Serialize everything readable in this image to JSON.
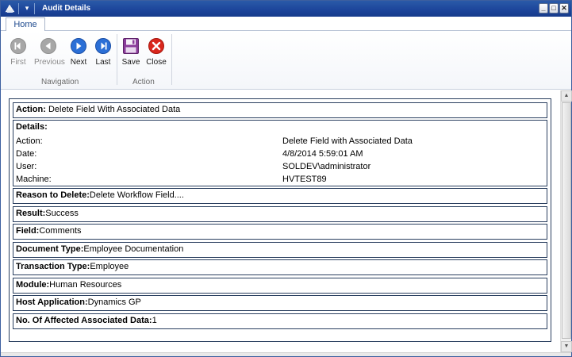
{
  "window": {
    "title": "Audit Details",
    "controls": {
      "minimize": "_",
      "maximize": "□",
      "close": "✕"
    }
  },
  "ribbon": {
    "tabs": [
      {
        "label": "Home"
      }
    ],
    "groups": [
      {
        "label": "Navigation",
        "buttons": [
          {
            "label": "First",
            "icon": "first-icon",
            "enabled": false
          },
          {
            "label": "Previous",
            "icon": "previous-icon",
            "enabled": false
          },
          {
            "label": "Next",
            "icon": "next-icon",
            "enabled": true
          },
          {
            "label": "Last",
            "icon": "last-icon",
            "enabled": true
          }
        ]
      },
      {
        "label": "Action",
        "buttons": [
          {
            "label": "Save",
            "icon": "save-icon",
            "enabled": true
          },
          {
            "label": "Close",
            "icon": "close-icon",
            "enabled": true
          }
        ]
      }
    ]
  },
  "audit": {
    "action": {
      "label": "Action:",
      "value": " Delete Field With Associated Data"
    },
    "details": {
      "label": "Details:",
      "rows": [
        {
          "label": "Action:",
          "value": "Delete Field with Associated Data"
        },
        {
          "label": "Date:",
          "value": "4/8/2014 5:59:01 AM"
        },
        {
          "label": "User:",
          "value": "SOLDEV\\administrator"
        },
        {
          "label": "Machine:",
          "value": "HVTEST89"
        }
      ]
    },
    "reason": {
      "label": "Reason to Delete:",
      "value": "Delete Workflow Field...."
    },
    "result": {
      "label": "Result:",
      "value": "Success"
    },
    "field": {
      "label": "Field:",
      "value": "Comments"
    },
    "document_type": {
      "label": "Document Type:",
      "value": "Employee Documentation"
    },
    "transaction_type": {
      "label": "Transaction Type:",
      "value": "Employee"
    },
    "module": {
      "label": "Module:",
      "value": "Human Resources"
    },
    "host_application": {
      "label": "Host Application:",
      "value": "Dynamics GP"
    },
    "affected": {
      "label": "No. Of Affected Associated Data:",
      "value": "1"
    }
  },
  "colors": {
    "titlebar": "#1c449a",
    "nav_blue": "#2b6fd6",
    "nav_disabled": "#a7a7a7",
    "save_purple": "#8a3c9a",
    "close_red": "#d9261c",
    "border": "#2a3f5f"
  }
}
